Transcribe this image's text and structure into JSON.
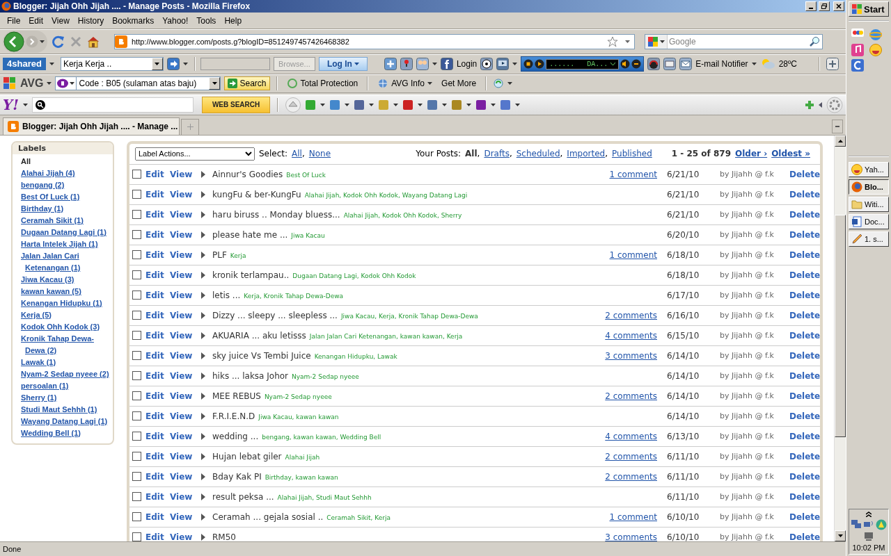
{
  "window": {
    "title": "Blogger: Jijah Ohh Jijah .... - Manage Posts - Mozilla Firefox"
  },
  "menu": [
    "File",
    "Edit",
    "View",
    "History",
    "Bookmarks",
    "Yahoo!",
    "Tools",
    "Help"
  ],
  "navigation": {
    "url": "http://www.blogger.com/posts.g?blogID=8512497457426468382",
    "search": {
      "placeholder": "Google"
    }
  },
  "toolbar_4shared": {
    "logo": "4shared",
    "folder": "Kerja Kerja ..",
    "browse": "Browse...",
    "login": "Log In",
    "facebook": "Login",
    "player_display": "......   DA...",
    "email": "E-mail Notifier",
    "weather": "28ºC"
  },
  "toolbar_avg": {
    "logo": "AVG",
    "search_text": "Code : B05 (sulaman atas baju)",
    "search_button": "Search",
    "items": [
      "Total Protection",
      "AVG Info",
      "Get More"
    ]
  },
  "toolbar_yahoo": {
    "logo": "Y!",
    "button": "WEB SEARCH"
  },
  "tabs": [
    {
      "label": "Blogger: Jijah Ohh Jijah .... - Manage ...",
      "selected": true
    }
  ],
  "sidebar": {
    "title": "Labels",
    "items": [
      {
        "label": "All",
        "selected": true
      },
      {
        "label": "Alahai Jijah (4)",
        "selected": false
      },
      {
        "label": "bengang (2)",
        "selected": false
      },
      {
        "label": "Best Of Luck (1)",
        "selected": false
      },
      {
        "label": "Birthday (1)",
        "selected": false
      },
      {
        "label": "Ceramah Sikit (1)",
        "selected": false
      },
      {
        "label": "Dugaan Datang Lagi (1)",
        "selected": false
      },
      {
        "label": "Harta Intelek Jijah (1)",
        "selected": false
      },
      {
        "label": "Jalan Jalan Cari Ketenangan (1)",
        "selected": false
      },
      {
        "label": "Jiwa Kacau (3)",
        "selected": false
      },
      {
        "label": "kawan kawan (5)",
        "selected": false
      },
      {
        "label": "Kenangan Hidupku (1)",
        "selected": false
      },
      {
        "label": "Kerja (5)",
        "selected": false
      },
      {
        "label": "Kodok Ohh Kodok (3)",
        "selected": false
      },
      {
        "label": "Kronik Tahap Dewa-Dewa (2)",
        "selected": false
      },
      {
        "label": "Lawak (1)",
        "selected": false
      },
      {
        "label": "Nyam-2 Sedap nyeee (2)",
        "selected": false
      },
      {
        "label": "persoalan (1)",
        "selected": false
      },
      {
        "label": "Sherry (1)",
        "selected": false
      },
      {
        "label": "Studi Maut Sehhh (1)",
        "selected": false
      },
      {
        "label": "Wayang Datang Lagi (1)",
        "selected": false
      },
      {
        "label": "Wedding Bell (1)",
        "selected": false
      }
    ]
  },
  "posts": {
    "label_actions": "Label Actions...",
    "select_label": "Select:",
    "select_links": [
      {
        "label": "All",
        "separator": ","
      },
      {
        "label": "None"
      }
    ],
    "your_posts": "Your Posts:",
    "filters": [
      {
        "label": "All",
        "selected": true,
        "separator": ","
      },
      {
        "label": "Drafts",
        "selected": false,
        "separator": ","
      },
      {
        "label": "Scheduled",
        "selected": false,
        "separator": ","
      },
      {
        "label": "Imported",
        "selected": false,
        "separator": ","
      },
      {
        "label": "Published",
        "selected": false
      }
    ],
    "range": "1 - 25 of 879",
    "pager": [
      "Older ›",
      "Oldest »"
    ],
    "rows": [
      {
        "checked": false,
        "edit": "Edit",
        "view": "View",
        "title": "Ainnur's Goodies",
        "labels": "Best Of Luck",
        "comments": "1 comment",
        "date": "6/21/10",
        "author": "by Jijahh @ f.k",
        "delete": "Delete"
      },
      {
        "checked": false,
        "edit": "Edit",
        "view": "View",
        "title": "kungFu & ber-KungFu",
        "labels": "Alahai Jijah, Kodok Ohh Kodok, Wayang Datang Lagi",
        "date": "6/21/10",
        "author": "by Jijahh @ f.k",
        "delete": "Delete"
      },
      {
        "checked": false,
        "edit": "Edit",
        "view": "View",
        "title": "haru biruss .. Monday bluess...",
        "labels": "Alahai Jijah, Kodok Ohh Kodok, Sherry",
        "date": "6/21/10",
        "author": "by Jijahh @ f.k",
        "delete": "Delete"
      },
      {
        "checked": false,
        "edit": "Edit",
        "view": "View",
        "title": "please hate me ...",
        "labels": "Jiwa Kacau",
        "date": "6/20/10",
        "author": "by Jijahh @ f.k",
        "delete": "Delete"
      },
      {
        "checked": false,
        "edit": "Edit",
        "view": "View",
        "title": "PLF",
        "labels": "Kerja",
        "comments": "1 comment",
        "date": "6/18/10",
        "author": "by Jijahh @ f.k",
        "delete": "Delete"
      },
      {
        "checked": false,
        "edit": "Edit",
        "view": "View",
        "title": "kronik terlampau..",
        "labels": "Dugaan Datang Lagi, Kodok Ohh Kodok",
        "date": "6/18/10",
        "author": "by Jijahh @ f.k",
        "delete": "Delete"
      },
      {
        "checked": false,
        "edit": "Edit",
        "view": "View",
        "title": "letis ...",
        "labels": "Kerja, Kronik Tahap Dewa-Dewa",
        "date": "6/17/10",
        "author": "by Jijahh @ f.k",
        "delete": "Delete"
      },
      {
        "checked": false,
        "edit": "Edit",
        "view": "View",
        "title": "Dizzy ... sleepy ... sleepless ...",
        "labels": "Jiwa Kacau, Kerja, Kronik Tahap Dewa-Dewa",
        "comments": "2 comments",
        "date": "6/16/10",
        "author": "by Jijahh @ f.k",
        "delete": "Delete"
      },
      {
        "checked": false,
        "edit": "Edit",
        "view": "View",
        "title": "AKUARIA ... aku letisss",
        "labels": "Jalan Jalan Cari Ketenangan, kawan kawan, Kerja",
        "comments": "4 comments",
        "date": "6/15/10",
        "author": "by Jijahh @ f.k",
        "delete": "Delete"
      },
      {
        "checked": false,
        "edit": "Edit",
        "view": "View",
        "title": "sky juice Vs Tembi Juice",
        "labels": "Kenangan Hidupku, Lawak",
        "comments": "3 comments",
        "date": "6/14/10",
        "author": "by Jijahh @ f.k",
        "delete": "Delete"
      },
      {
        "checked": false,
        "edit": "Edit",
        "view": "View",
        "title": "hiks ... laksa Johor",
        "labels": "Nyam-2 Sedap nyeee",
        "date": "6/14/10",
        "author": "by Jijahh @ f.k",
        "delete": "Delete"
      },
      {
        "checked": false,
        "edit": "Edit",
        "view": "View",
        "title": "MEE REBUS",
        "labels": "Nyam-2 Sedap nyeee",
        "comments": "2 comments",
        "date": "6/14/10",
        "author": "by Jijahh @ f.k",
        "delete": "Delete"
      },
      {
        "checked": false,
        "edit": "Edit",
        "view": "View",
        "title": "F.R.I.E.N.D",
        "labels": "Jiwa Kacau, kawan kawan",
        "date": "6/14/10",
        "author": "by Jijahh @ f.k",
        "delete": "Delete"
      },
      {
        "checked": false,
        "edit": "Edit",
        "view": "View",
        "title": "wedding ...",
        "labels": "bengang, kawan kawan, Wedding Bell",
        "comments": "4 comments",
        "date": "6/13/10",
        "author": "by Jijahh @ f.k",
        "delete": "Delete"
      },
      {
        "checked": false,
        "edit": "Edit",
        "view": "View",
        "title": "Hujan lebat giler",
        "labels": "Alahai Jijah",
        "comments": "2 comments",
        "date": "6/11/10",
        "author": "by Jijahh @ f.k",
        "delete": "Delete"
      },
      {
        "checked": false,
        "edit": "Edit",
        "view": "View",
        "title": "Bday Kak PI",
        "labels": "Birthday, kawan kawan",
        "comments": "2 comments",
        "date": "6/11/10",
        "author": "by Jijahh @ f.k",
        "delete": "Delete"
      },
      {
        "checked": false,
        "edit": "Edit",
        "view": "View",
        "title": "result peksa ...",
        "labels": "Alahai Jijah, Studi Maut Sehhh",
        "date": "6/11/10",
        "author": "by Jijahh @ f.k",
        "delete": "Delete"
      },
      {
        "checked": false,
        "edit": "Edit",
        "view": "View",
        "title": "Ceramah ... gejala sosial ..",
        "labels": "Ceramah Sikit, Kerja",
        "comments": "1 comment",
        "date": "6/10/10",
        "author": "by Jijahh @ f.k",
        "delete": "Delete"
      },
      {
        "checked": false,
        "edit": "Edit",
        "view": "View",
        "title": "RM50",
        "comments": "3 comments",
        "date": "6/10/10",
        "author": "by Jijahh @ f.k",
        "delete": "Delete"
      }
    ]
  },
  "status_bar": {
    "text": "Done"
  },
  "taskbar": {
    "start": "Start",
    "tasks": [
      {
        "label": "Yah...",
        "selected": false
      },
      {
        "label": "Blo...",
        "selected": true
      },
      {
        "label": "Witi...",
        "selected": false
      },
      {
        "label": "Doc...",
        "selected": false
      },
      {
        "label": "1. s...",
        "selected": false
      }
    ],
    "clock": "10:02 PM"
  }
}
